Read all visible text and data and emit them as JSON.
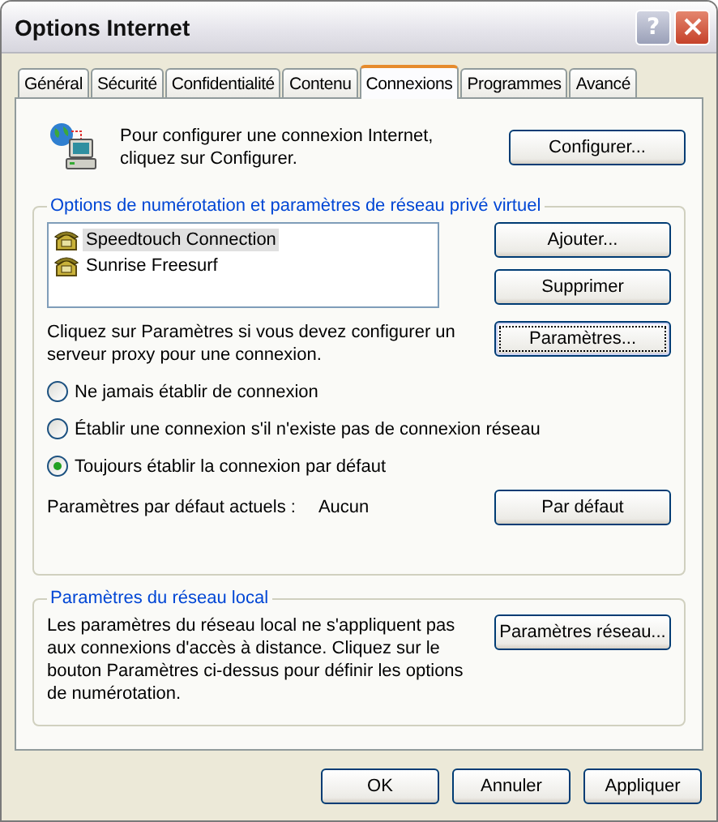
{
  "window": {
    "title": "Options Internet"
  },
  "title_buttons": [
    {
      "kind": "help",
      "label": "?"
    },
    {
      "kind": "close"
    }
  ],
  "tabs": [
    {
      "label": "Général",
      "selected": false
    },
    {
      "label": "Sécurité",
      "selected": false
    },
    {
      "label": "Confidentialité",
      "selected": false
    },
    {
      "label": "Contenu",
      "selected": false
    },
    {
      "label": "Connexions",
      "selected": true
    },
    {
      "label": "Programmes",
      "selected": false
    },
    {
      "label": "Avancé",
      "selected": false
    }
  ],
  "setup": {
    "text": "Pour configurer une connexion Internet, cliquez sur Configurer.",
    "button": "Configurer..."
  },
  "dialup": {
    "title": "Options de numérotation et paramètres de réseau privé virtuel",
    "connections": [
      {
        "name": "Speedtouch Connection",
        "selected": true
      },
      {
        "name": "Sunrise Freesurf",
        "selected": false
      }
    ],
    "list_buttons": [
      "Ajouter...",
      "Supprimer"
    ],
    "proxy_text": "Cliquez sur Paramètres si vous devez configurer un serveur proxy pour une connexion.",
    "proxy_button": "Paramètres...",
    "options": [
      {
        "label": "Ne jamais établir de connexion",
        "selected": false
      },
      {
        "label": "Établir une connexion s'il n'existe pas de connexion réseau",
        "selected": false
      },
      {
        "label": "Toujours établir la connexion par défaut",
        "selected": true
      }
    ],
    "default_label": "Paramètres par défaut actuels :",
    "default_value": "Aucun",
    "default_button": "Par défaut"
  },
  "lan": {
    "title": "Paramètres du réseau local",
    "text": "Les paramètres du réseau local ne s'appliquent pas aux connexions d'accès à distance. Cliquez sur le bouton Paramètres ci-dessus pour définir les options de numérotation.",
    "button": "Paramètres réseau..."
  },
  "buttons": [
    "OK",
    "Annuler",
    "Appliquer"
  ]
}
